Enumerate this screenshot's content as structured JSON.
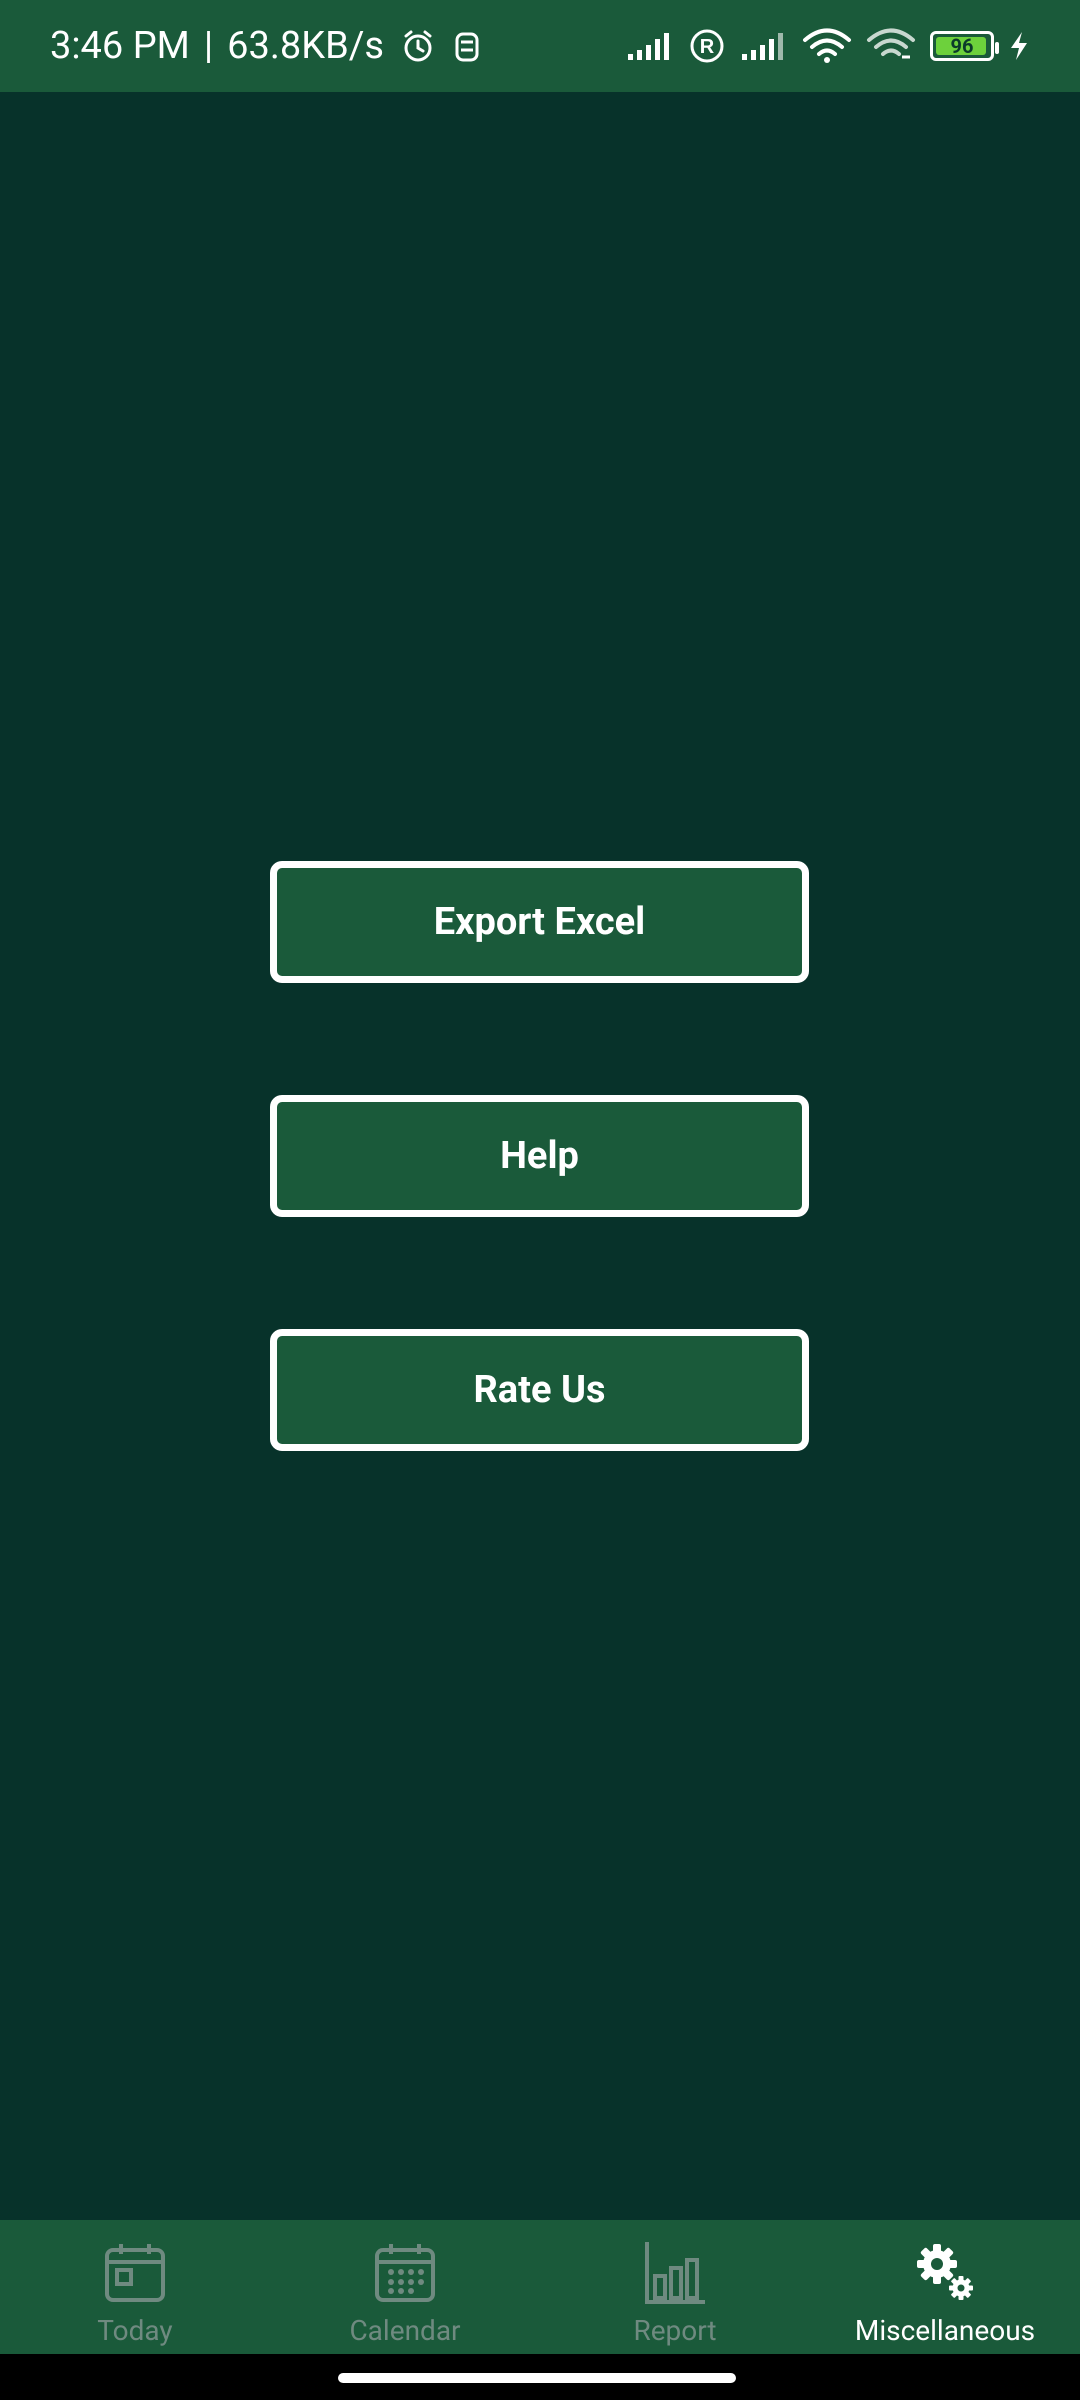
{
  "status_bar": {
    "time": "3:46 PM",
    "network_speed": "63.8KB/s",
    "battery_level": "96",
    "icons": [
      "alarm-icon",
      "clock-app-icon",
      "signal-icon",
      "registered-icon",
      "signal-icon",
      "wifi-icon",
      "wifi-link-icon",
      "battery-icon",
      "charging-icon"
    ]
  },
  "buttons": {
    "export_excel": "Export Excel",
    "help": "Help",
    "rate_us": "Rate Us"
  },
  "bottom_nav": {
    "items": [
      {
        "label": "Today",
        "icon": "calendar-today-icon",
        "active": false
      },
      {
        "label": "Calendar",
        "icon": "calendar-icon",
        "active": false
      },
      {
        "label": "Report",
        "icon": "bar-chart-icon",
        "active": false
      },
      {
        "label": "Miscellaneous",
        "icon": "gears-icon",
        "active": true
      }
    ]
  },
  "colors": {
    "background": "#07322a",
    "bar": "#1a5a3a",
    "inactive": "#6f8a80",
    "active": "#ffffff",
    "battery": "#6dd13c"
  }
}
